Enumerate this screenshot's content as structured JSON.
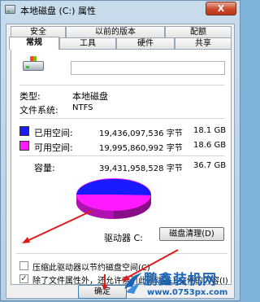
{
  "window": {
    "title": "本地磁盘 (C:) 属性",
    "close_label": "X"
  },
  "tabs_row1": [
    {
      "label": "安全"
    },
    {
      "label": "以前的版本"
    },
    {
      "label": "配额"
    }
  ],
  "tabs_row2": [
    {
      "label": "常规",
      "active": true
    },
    {
      "label": "工具"
    },
    {
      "label": "硬件"
    },
    {
      "label": "共享"
    }
  ],
  "general": {
    "drive_name_value": "",
    "type_label": "类型:",
    "type_value": "本地磁盘",
    "fs_label": "文件系统:",
    "fs_value": "NTFS",
    "used": {
      "label": "已用空间:",
      "bytes": "19,436,097,536 字节",
      "size": "18.1 GB",
      "color": "#1a1aff"
    },
    "free": {
      "label": "可用空间:",
      "bytes": "19,995,860,992 字节",
      "size": "18.6 GB",
      "color": "#ff1aff"
    },
    "capacity": {
      "label": "容量:",
      "bytes": "39,431,958,528 字节",
      "size": "36.7 GB"
    },
    "drive_letter": "驱动器 C:",
    "cleanup_button": "磁盘清理(D)",
    "used_fraction": 0.493
  },
  "options": {
    "compress_label": "压缩此驱动器以节约磁盘空间(C)",
    "compress_checked": false,
    "index_label": "除了文件属性外，还允许索引此驱动器上文件的内容(I)",
    "index_checked": true
  },
  "buttons": {
    "ok_label": "确定"
  },
  "watermark": {
    "title": "鹏鑫装机网",
    "url": "www.0753px.com"
  }
}
